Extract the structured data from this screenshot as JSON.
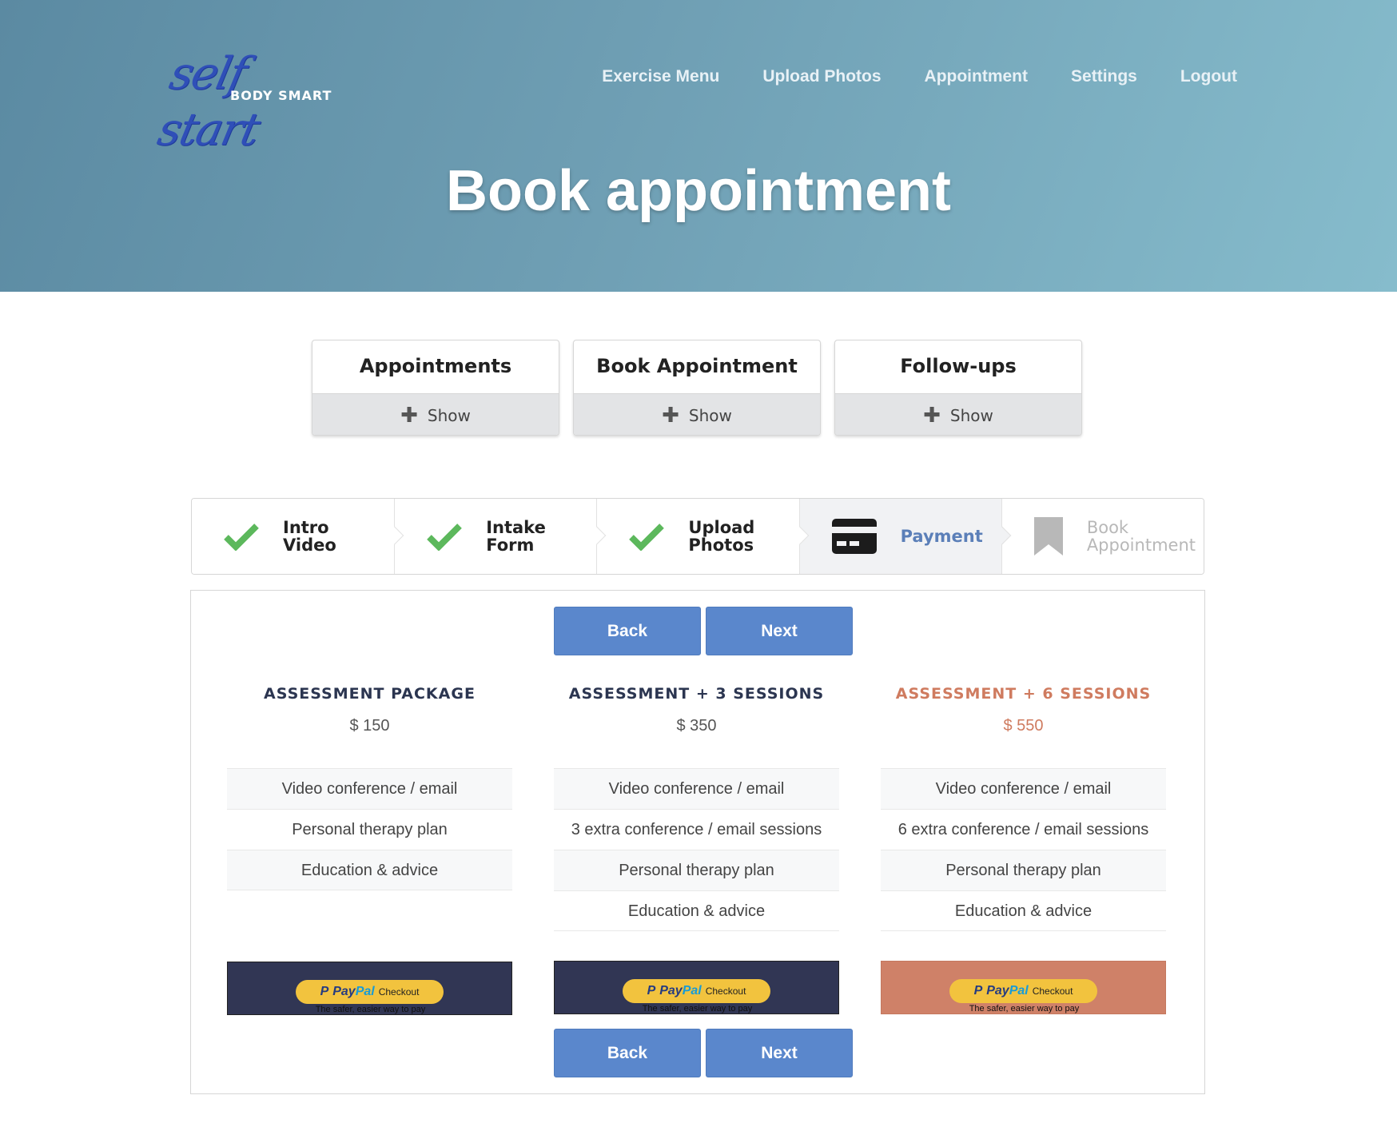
{
  "brand": {
    "script": "self start",
    "sub": "BODY SMART"
  },
  "nav": [
    {
      "label": "Exercise Menu"
    },
    {
      "label": "Upload Photos"
    },
    {
      "label": "Appointment"
    },
    {
      "label": "Settings"
    },
    {
      "label": "Logout"
    }
  ],
  "hero": {
    "title": "Book appointment"
  },
  "cards": [
    {
      "title": "Appointments",
      "show": "Show"
    },
    {
      "title": "Book Appointment",
      "show": "Show"
    },
    {
      "title": "Follow-ups",
      "show": "Show"
    }
  ],
  "stepper": [
    {
      "label1": "Intro",
      "label2": "Video",
      "state": "done",
      "icon": "check-icon"
    },
    {
      "label1": "Intake",
      "label2": "Form",
      "state": "done",
      "icon": "check-icon"
    },
    {
      "label1": "Upload",
      "label2": "Photos",
      "state": "done",
      "icon": "check-icon"
    },
    {
      "label1": "Payment",
      "label2": "",
      "state": "active",
      "icon": "credit-card-icon"
    },
    {
      "label1": "Book",
      "label2": "Appointment",
      "state": "disabled",
      "icon": "bookmark-icon"
    }
  ],
  "buttons": {
    "back": "Back",
    "next": "Next"
  },
  "plans": [
    {
      "name": "ASSESSMENT PACKAGE",
      "price": "$ 150",
      "features": [
        "Video conference / email",
        "Personal therapy plan",
        "Education & advice"
      ]
    },
    {
      "name": "ASSESSMENT + 3 SESSIONS",
      "price": "$ 350",
      "features": [
        "Video conference / email",
        "3 extra conference / email sessions",
        "Personal therapy plan",
        "Education & advice"
      ]
    },
    {
      "name": "ASSESSMENT + 6 SESSIONS",
      "price": "$ 550",
      "features": [
        "Video conference / email",
        "6 extra conference / email sessions",
        "Personal therapy plan",
        "Education & advice"
      ]
    }
  ],
  "paypal": {
    "p": "P",
    "pay": "Pay",
    "pal": "Pal",
    "checkout": "Checkout",
    "tagline": "The safer, easier way to pay"
  },
  "colors": {
    "accent": "#5a87cc",
    "featured": "#cf7b5f",
    "check": "#5cb85c",
    "navy": "#313654"
  }
}
